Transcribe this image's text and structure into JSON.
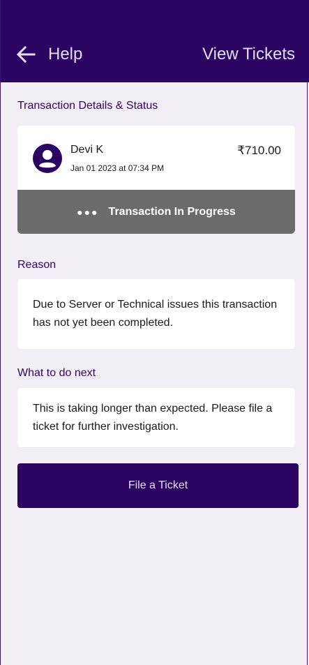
{
  "header": {
    "title": "Help",
    "action_label": "View Tickets",
    "colors": {
      "background": "#2b0561",
      "text": "#e4dbf2"
    }
  },
  "transaction_section": {
    "label": "Transaction Details & Status",
    "payee_name": "Devi K",
    "date": "Jan 01 2023 at 07:34 PM",
    "amount": "₹710.00",
    "status_icon": "dots-icon",
    "status_text": "Transaction In Progress",
    "status_color": "#6b6b6b"
  },
  "reason_section": {
    "label": "Reason",
    "text": "Due to Server or Technical issues this transaction has not yet been completed."
  },
  "next_section": {
    "label": "What to do next",
    "text": "This is taking longer than expected. Please file a ticket for further investigation."
  },
  "primary_button": {
    "label": "File a Ticket",
    "color": "#2b0561"
  }
}
